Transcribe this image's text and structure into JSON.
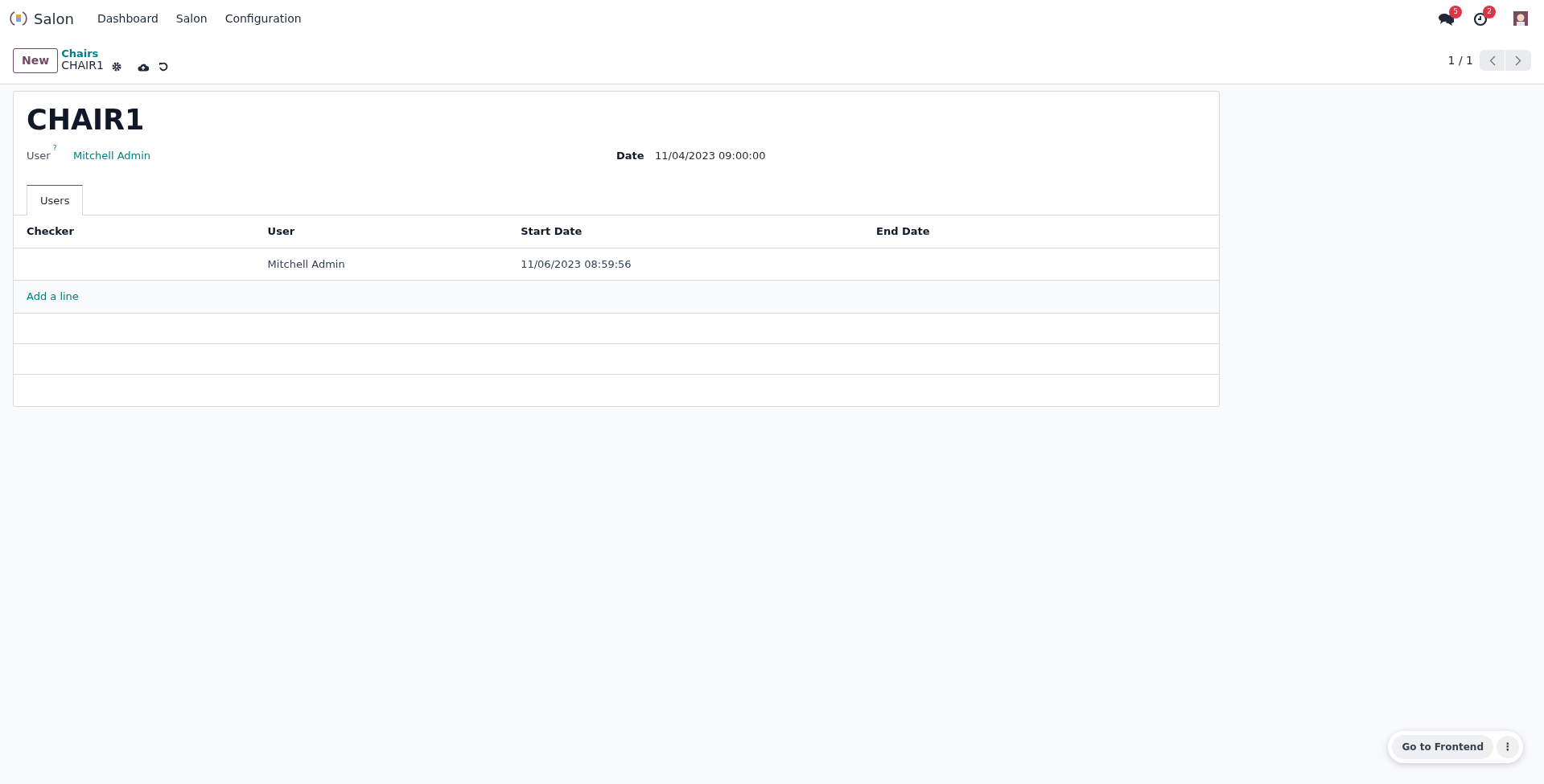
{
  "navbar": {
    "app_name": "Salon",
    "menu": [
      "Dashboard",
      "Salon",
      "Configuration"
    ],
    "messages_badge": "5",
    "activities_badge": "2"
  },
  "control_panel": {
    "new_button": "New",
    "breadcrumb_parent": "Chairs",
    "breadcrumb_current": "CHAIR1",
    "pager": "1 / 1"
  },
  "form": {
    "title": "CHAIR1",
    "fields": [
      {
        "kind": "link",
        "label": "User",
        "help": "?",
        "value": "Mitchell Admin"
      },
      {
        "kind": "text",
        "label": "Date",
        "value": "11/04/2023 09:00:00"
      }
    ],
    "tabs": [
      {
        "label": "Users",
        "selected": true
      }
    ],
    "table": {
      "columns": [
        "Checker",
        "User",
        "Start Date",
        "End Date"
      ],
      "rows": [
        {
          "user": "Mitchell Admin",
          "start_date": "11/06/2023 08:59:56"
        }
      ],
      "add_line": "Add a line"
    }
  },
  "floating": {
    "button": "Go to Frontend",
    "more": "⋮"
  }
}
